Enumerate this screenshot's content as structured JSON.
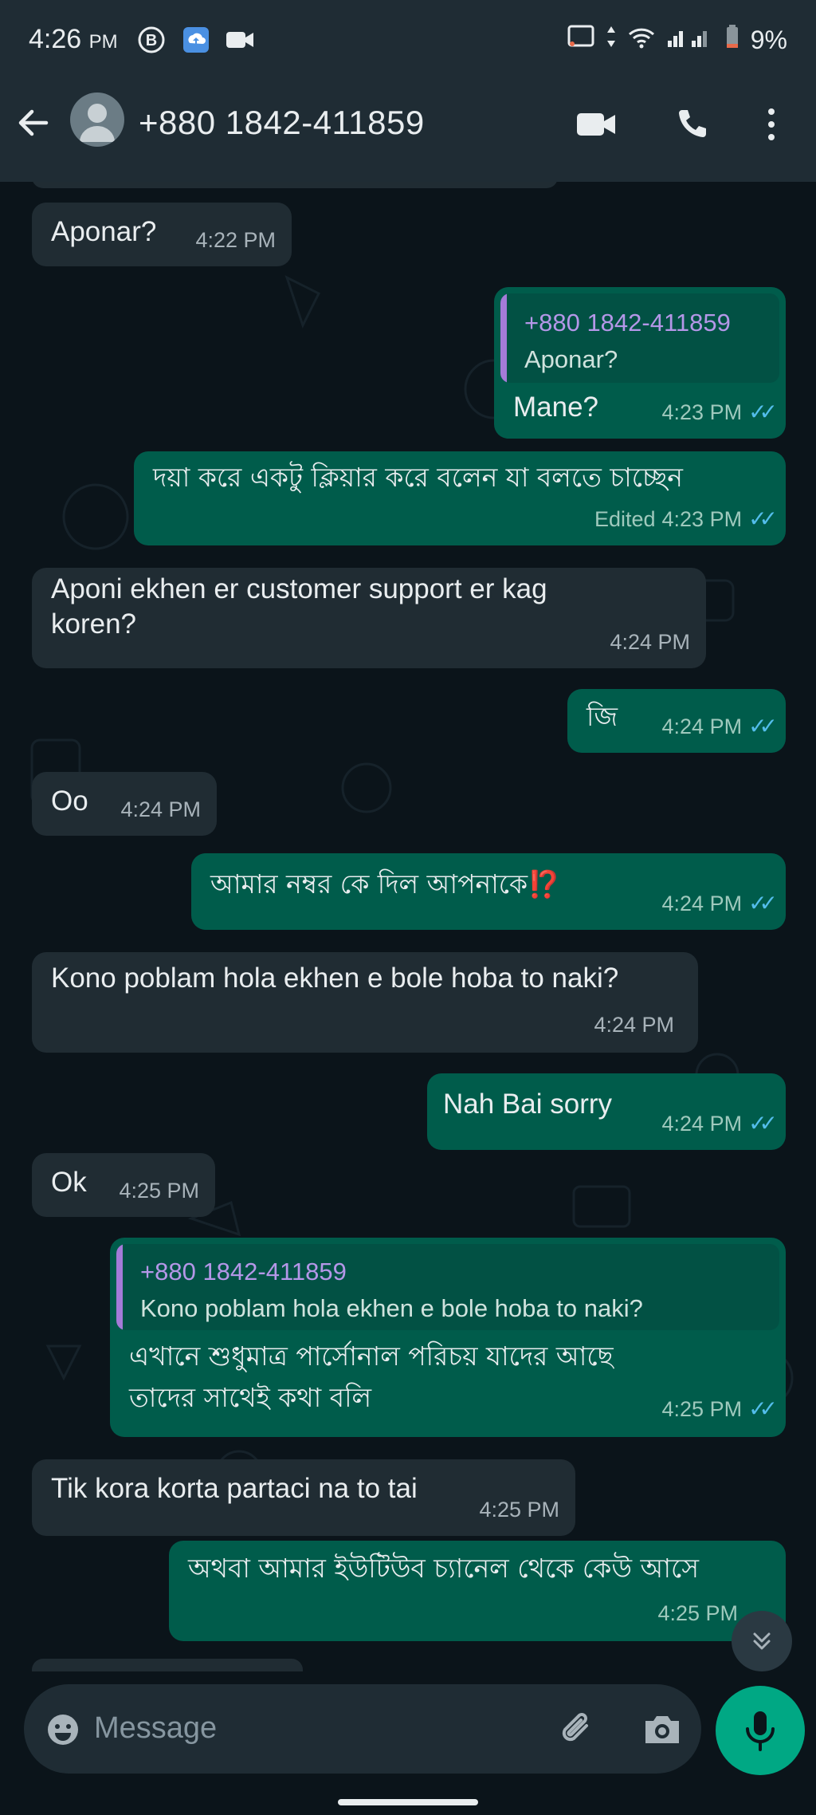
{
  "status_bar": {
    "time": "4:26",
    "ampm": "PM",
    "battery": "9%"
  },
  "header": {
    "contact": "+880 1842-411859",
    "icons": [
      "back-arrow-icon",
      "video-call-icon",
      "voice-call-icon",
      "more-options-icon"
    ]
  },
  "messages": [
    {
      "dir": "in",
      "text": "Aponar?",
      "time": "4:22 PM"
    },
    {
      "dir": "out",
      "reply_to": {
        "name": "+880 1842-411859",
        "text": "Aponar?"
      },
      "text": "Mane?",
      "time": "4:23 PM"
    },
    {
      "dir": "out",
      "text": "দয়া করে একটু ক্লিয়ার করে বলেন যা বলতে চাচ্ছেন",
      "edited": "Edited",
      "time": "4:23 PM"
    },
    {
      "dir": "in",
      "text": "Aponi ekhen er customer support er kag",
      "text2": "koren?",
      "time": "4:24 PM"
    },
    {
      "dir": "out",
      "text": "জি",
      "time": "4:24 PM"
    },
    {
      "dir": "in",
      "text": "Oo",
      "time": "4:24 PM"
    },
    {
      "dir": "out",
      "text": "আমার নম্বর কে দিল আপনাকে",
      "emoji": "⁉️",
      "time": "4:24 PM"
    },
    {
      "dir": "in",
      "text": "Kono poblam hola ekhen e bole hoba to naki?",
      "time": "4:24 PM"
    },
    {
      "dir": "out",
      "text": "Nah Bai sorry",
      "time": "4:24 PM"
    },
    {
      "dir": "in",
      "text": "Ok",
      "time": "4:25 PM"
    },
    {
      "dir": "out",
      "reply_to": {
        "name": "+880 1842-411859",
        "text": "Kono poblam hola ekhen e bole hoba to naki?"
      },
      "text": "এখানে শুধুমাত্র পার্সোনাল পরিচয় যাদের আছে",
      "text2": "তাদের সাথেই কথা বলি",
      "time": "4:25 PM"
    },
    {
      "dir": "in",
      "text": "Tik kora korta partaci na to tai",
      "time": "4:25 PM"
    },
    {
      "dir": "out",
      "text": "অথবা আমার ইউটিউব চ্যানেল থেকে কেউ আসে",
      "time": "4:25 PM"
    }
  ],
  "input": {
    "placeholder": "Message"
  },
  "colors": {
    "background": "#0b141a",
    "bar": "#1f2c34",
    "incoming": "#202c33",
    "outgoing": "#005c4b",
    "accent": "#00a884",
    "read_tick": "#53bdeb"
  }
}
